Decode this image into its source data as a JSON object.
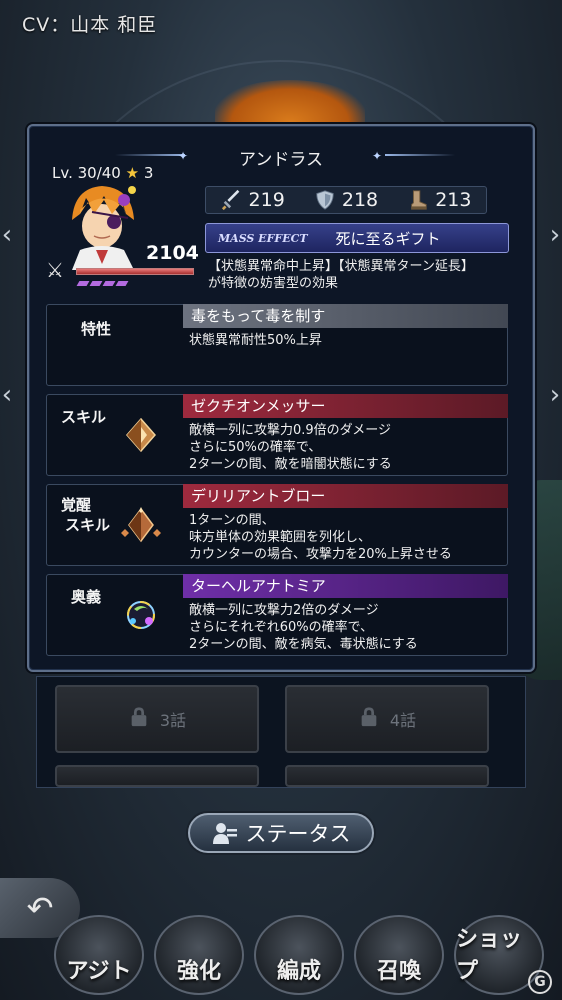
{
  "cv_label": "CV：山本 和臣",
  "character": {
    "name": "アンドラス",
    "level_text": "Lv. 30/40",
    "stars": "3",
    "power": "2104",
    "hp_fraction": 1.0
  },
  "stats": [
    {
      "icon": "sword-icon",
      "value": "219"
    },
    {
      "icon": "shield-icon",
      "value": "218"
    },
    {
      "icon": "boot-icon",
      "value": "213"
    }
  ],
  "mass_effect": {
    "tag": "MASS EFFECT",
    "name": "死に至るギフト",
    "description_1": "【状態異常命中上昇】【状態異常ターン延長】",
    "description_2": "が特徴の妨害型の効果"
  },
  "trait": {
    "label": "特性",
    "name": "毒をもって毒を制す",
    "lines": [
      "状態異常耐性50%上昇"
    ]
  },
  "skill": {
    "label": "スキル",
    "name": "ゼクチオンメッサー",
    "lines": [
      "敵横一列に攻撃力0.9倍のダメージ",
      "さらに50%の確率で、",
      "2ターンの間、敵を暗闇状態にする"
    ]
  },
  "awaken_skill": {
    "label_1": "覚醒",
    "label_2": "スキル",
    "name": "デリリアントブロー",
    "lines": [
      "1ターンの間、",
      "味方単体の効果範囲を列化し、",
      "カウンターの場合、攻撃力を20%上昇させる"
    ]
  },
  "ougi": {
    "label": "奥義",
    "name": "ターヘルアナトミア",
    "lines": [
      "敵横一列に攻撃力2倍のダメージ",
      "さらにそれぞれ60%の確率で、",
      "2ターンの間、敵を病気、毒状態にする"
    ]
  },
  "chapters": [
    {
      "label": "3話",
      "locked": true
    },
    {
      "label": "4話",
      "locked": true
    }
  ],
  "status_button": "ステータス",
  "nav": [
    {
      "label": "アジト",
      "icon": "hideout-icon"
    },
    {
      "label": "強化",
      "icon": "enhance-icon"
    },
    {
      "label": "編成",
      "icon": "formation-icon"
    },
    {
      "label": "召喚",
      "icon": "summon-icon"
    },
    {
      "label": "ショップ",
      "icon": "shop-icon"
    }
  ],
  "watermark": "G"
}
